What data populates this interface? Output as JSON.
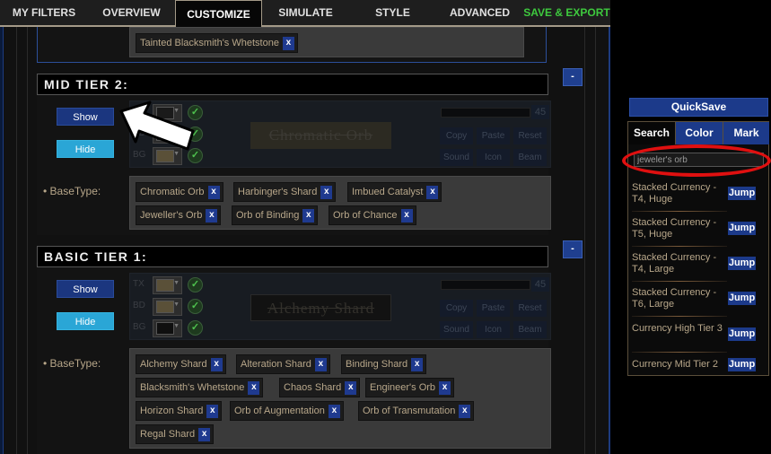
{
  "nav": {
    "tabs": [
      {
        "label": "MY FILTERS",
        "active": false
      },
      {
        "label": "OVERVIEW",
        "active": false
      },
      {
        "label": "CUSTOMIZE",
        "active": true
      },
      {
        "label": "SIMULATE",
        "active": false
      },
      {
        "label": "STYLE",
        "active": false
      },
      {
        "label": "ADVANCED",
        "active": false
      },
      {
        "label": "SAVE & EXPORT",
        "active": false
      }
    ]
  },
  "prev_section": {
    "basetypes": [
      "Tainted Blacksmith's Whetstone"
    ]
  },
  "sections": [
    {
      "title": "MID TIER 2:",
      "collapse_label": "-",
      "show_label": "Show",
      "hide_label": "Hide",
      "style": {
        "labels": [
          "TX",
          "BD",
          "BG"
        ],
        "swatch_colors": [
          "#1a1a1a",
          "#1a1a1a",
          "#5a5038"
        ],
        "preview_text": "Chromatic Orb",
        "preview_color": "#3c3a34",
        "preview_bg": "#2c2a22",
        "font_size_value": "45",
        "buttons": [
          "Copy",
          "Paste",
          "Reset",
          "Sound",
          "Icon",
          "Beam"
        ]
      },
      "basetype_label": "• BaseType:",
      "basetypes": [
        "Chromatic Orb",
        "Harbinger's Shard",
        "Imbued Catalyst",
        "Jeweller's Orb",
        "Orb of Binding",
        "Orb of Chance"
      ],
      "remove_label": "x"
    },
    {
      "title": "BASIC TIER 1:",
      "collapse_label": "-",
      "show_label": "Show",
      "hide_label": "Hide",
      "style": {
        "labels": [
          "TX",
          "BD",
          "BG"
        ],
        "swatch_colors": [
          "#5a5038",
          "#5a5038",
          "#0f0f0f"
        ],
        "preview_text": "Alchemy Shard",
        "preview_color": "#33312c",
        "preview_bg": "#121212",
        "font_size_value": "45",
        "buttons": [
          "Copy",
          "Paste",
          "Reset",
          "Sound",
          "Icon",
          "Beam"
        ]
      },
      "basetype_label": "• BaseType:",
      "basetypes": [
        "Alchemy Shard",
        "Alteration Shard",
        "Binding Shard",
        "Blacksmith's Whetstone",
        "Chaos Shard",
        "Engineer's Orb",
        "Horizon Shard",
        "Orb of Augmentation",
        "Orb of Transmutation",
        "Regal Shard"
      ],
      "remove_label": "x"
    }
  ],
  "right_panel": {
    "quicksave_label": "QuickSave",
    "tabs": [
      {
        "label": "Search",
        "selected": true
      },
      {
        "label": "Color",
        "selected": false
      },
      {
        "label": "Mark",
        "selected": false
      }
    ],
    "search_value": "jeweler's orb",
    "results": [
      {
        "text": "Stacked Currency - T4, Huge",
        "jump_label": "Jump"
      },
      {
        "text": "Stacked Currency - T5, Huge",
        "jump_label": "Jump"
      },
      {
        "text": "Stacked Currency - T4, Large",
        "jump_label": "Jump"
      },
      {
        "text": "Stacked Currency - T6, Large",
        "jump_label": "Jump"
      },
      {
        "text": "Currency High Tier 3",
        "jump_label": "Jump"
      },
      {
        "text": "Currency Mid Tier 2",
        "jump_label": "Jump"
      }
    ]
  },
  "colors": {
    "accent_blue": "#1c3a8a",
    "hide_cyan": "#2aa6d6",
    "export_green": "#3ec93e",
    "highlight_red": "#e01010",
    "item_text": "#b8a78a"
  }
}
